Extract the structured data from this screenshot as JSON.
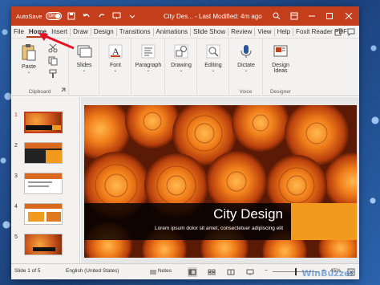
{
  "titlebar": {
    "autosave_label": "AutoSave",
    "autosave_state": "On",
    "title": "City Des... - Last Modified: 4m ago"
  },
  "tabs": [
    {
      "label": "File",
      "name": "tab-file"
    },
    {
      "label": "Home",
      "name": "tab-home",
      "active": true
    },
    {
      "label": "Insert",
      "name": "tab-insert"
    },
    {
      "label": "Draw",
      "name": "tab-draw"
    },
    {
      "label": "Design",
      "name": "tab-design"
    },
    {
      "label": "Transitions",
      "name": "tab-transitions"
    },
    {
      "label": "Animations",
      "name": "tab-animations"
    },
    {
      "label": "Slide Show",
      "name": "tab-slide-show"
    },
    {
      "label": "Review",
      "name": "tab-review"
    },
    {
      "label": "View",
      "name": "tab-view"
    },
    {
      "label": "Help",
      "name": "tab-help"
    },
    {
      "label": "Foxit Reader PDF",
      "name": "tab-foxit"
    }
  ],
  "ribbon": {
    "paste": "Paste",
    "clipboard": "Clipboard",
    "slides": "Slides",
    "font": "Font",
    "paragraph": "Paragraph",
    "drawing": "Drawing",
    "editing": "Editing",
    "dictate": "Dictate",
    "voice": "Voice",
    "design_ideas_1": "Design",
    "design_ideas_2": "Ideas",
    "designer": "Designer"
  },
  "thumbnails": [
    "1",
    "2",
    "3",
    "4",
    "5"
  ],
  "slide": {
    "title": "City Design",
    "subtitle": "Lorem ipsum dolor sit amet, consectetuer adipiscing elit"
  },
  "statusbar": {
    "slide_info": "Slide 1 of 5",
    "language": "English (United States)",
    "notes": "Notes",
    "zoom": "45%"
  },
  "watermark": "WinBuzzer",
  "colors": {
    "accent": "#c43e1c",
    "title_box": "#000000",
    "orange_box": "#f29a1e"
  }
}
